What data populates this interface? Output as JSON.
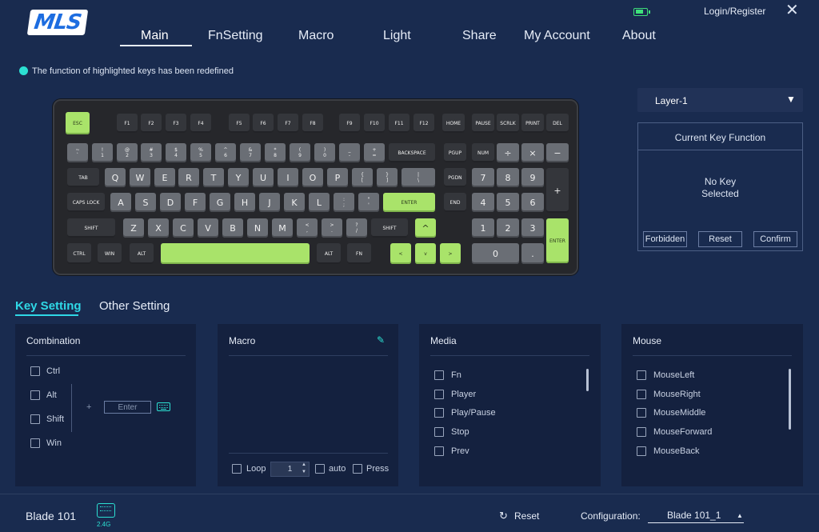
{
  "app": {
    "logo": "MLS"
  },
  "nav": [
    "Main",
    "FnSetting",
    "Macro",
    "Light",
    "Share",
    "My Account",
    "About"
  ],
  "header": {
    "login": "Login/Register",
    "battery_icon": "battery-icon",
    "close_icon": "close-icon"
  },
  "notice": "The function of highlighted keys has been redefined",
  "keyboard": {
    "row0": [
      "ESC",
      "F1",
      "F2",
      "F3",
      "F4",
      "F5",
      "F6",
      "F7",
      "F8",
      "F9",
      "F10",
      "F11",
      "F12",
      "HOME",
      "PAUSE",
      "SCRLK",
      "PRINT",
      "DEL"
    ],
    "row1": [
      "~\n`",
      "!\n1",
      "@\n2",
      "#\n3",
      "$\n4",
      "%\n5",
      "^\n6",
      "&\n7",
      "*\n8",
      "(\n9",
      ")\n0",
      "_\n-",
      "+\n=",
      "BACKSPACE",
      "PGUP",
      "NUM",
      "÷",
      "×",
      "−"
    ],
    "row2": [
      "TAB",
      "Q",
      "W",
      "E",
      "R",
      "T",
      "Y",
      "U",
      "I",
      "O",
      "P",
      "{\n[",
      "}\n]",
      "|\n\\",
      "PGDN",
      "7",
      "8",
      "9",
      "+"
    ],
    "row3": [
      "CAPS LOCK",
      "A",
      "S",
      "D",
      "F",
      "G",
      "H",
      "J",
      "K",
      "L",
      ":\n;",
      "\"\n'",
      "ENTER",
      "END",
      "4",
      "5",
      "6"
    ],
    "row4": [
      "SHIFT",
      "Z",
      "X",
      "C",
      "V",
      "B",
      "N",
      "M",
      "<\n,",
      ">\n.",
      "?\n/",
      "SHIFT",
      "^",
      "1",
      "2",
      "3",
      "ENTER"
    ],
    "row5": [
      "CTRL",
      "WIN",
      "ALT",
      "",
      "ALT",
      "FN",
      "<",
      "v",
      ">",
      "0",
      "."
    ]
  },
  "layer": {
    "selected": "Layer-1"
  },
  "current_key": {
    "title": "Current Key Function",
    "message_line1": "No Key",
    "message_line2": "Selected",
    "buttons": [
      "Forbidden",
      "Reset",
      "Confirm"
    ]
  },
  "tabs": {
    "key_setting": "Key Setting",
    "other_setting": "Other Setting"
  },
  "combination": {
    "title": "Combination",
    "items": [
      "Ctrl",
      "Alt",
      "Shift",
      "Win"
    ],
    "plus": "+",
    "enter_placeholder": "Enter"
  },
  "macro": {
    "title": "Macro",
    "loop": "Loop",
    "count": "1",
    "auto": "auto",
    "press": "Press"
  },
  "media": {
    "title": "Media",
    "items": [
      "Fn",
      "Player",
      "Play/Pause",
      "Stop",
      "Prev"
    ]
  },
  "mouse": {
    "title": "Mouse",
    "items": [
      "MouseLeft",
      "MouseRight",
      "MouseMiddle",
      "MouseForward",
      "MouseBack"
    ]
  },
  "footer": {
    "device": "Blade 101",
    "connection": "2.4G",
    "reset": "Reset",
    "config_label": "Configuration:",
    "config_value": "Blade 101_1"
  },
  "colors": {
    "accent": "#2ce0d2",
    "background": "#192b4f",
    "key_green": "#a9e36a",
    "key_gray": "#6a6e75",
    "key_dark": "#34363b"
  }
}
